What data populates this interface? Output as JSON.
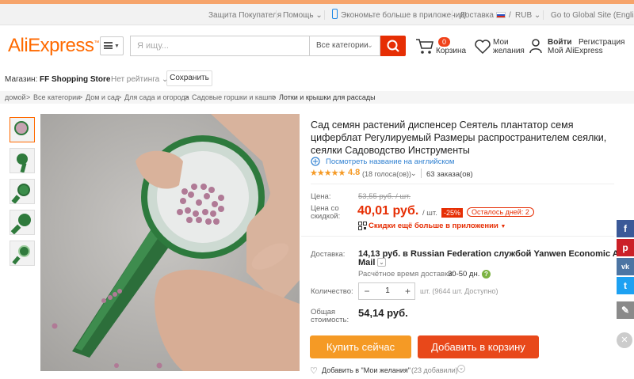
{
  "topbar": {
    "buyer_protection": "Защита Покупателя",
    "help": "Помощь",
    "help_chevron": "⌄",
    "app": "Экономьте больше в приложении!",
    "ship_to": "Доставка в",
    "sep": "/",
    "currency": "RUB",
    "currency_chevron": "⌄",
    "global": "Go to Global Site (English)"
  },
  "header": {
    "logo": "AliExpress",
    "logo_tm": "™",
    "search_placeholder": "Я ищу...",
    "category": "Все категории",
    "cart_count": "0",
    "cart_label": "Корзина",
    "wishlist_line1": "Мои",
    "wishlist_line2": "желания",
    "login": "Войти",
    "register": "Регистрация",
    "my_ali": "Мой AliExpress"
  },
  "store": {
    "label": "Магазин:",
    "name": "FF Shopping Store",
    "rating": "Нет рейтинга",
    "save_btn": "Сохранить"
  },
  "breadcrumb": [
    "домой",
    "Все категории",
    "Дом и сад",
    "Для сада и огорода",
    "Садовые горшки и кашпо",
    "Лотки и крышки для рассады"
  ],
  "breadcrumb_sep": ">",
  "product": {
    "title": "Сад семян растений диспенсер Сеятель плантатор семя циферблат Регулируемый Размеры распространителем сеялки, сеялки Садоводство Инструменты",
    "view_english": "Посмотреть название на английском",
    "stars": "★★★★★",
    "rating": "4.8",
    "reviews": "(18 голоса(ов))",
    "reviews_chevron": "⌄",
    "orders": "63 заказа(ов)",
    "price_label": "Цена:",
    "old_price": "53,55 руб. / шт.",
    "sale_label_1": "Цена со",
    "sale_label_2": "скидкой:",
    "sale_price": "40,01 руб.",
    "sale_unit": "/ шт.",
    "discount": "-25%",
    "days_left": "Осталось дней: 2",
    "app_discount": "Скидки ещё больше в приложении",
    "shipping_label": "Доставка:",
    "shipping_1": "14,13 руб. в Russian Federation службой Yanwen Economic Air",
    "shipping_2": "Mail",
    "est_label": "Расчётное время доставки:",
    "est_value": "30-50 дн.",
    "qty_label": "Количество:",
    "qty_minus": "−",
    "qty_value": "1",
    "qty_plus": "+",
    "qty_avail": "шт. (9644 шт. Доступно)",
    "total_label_1": "Общая",
    "total_label_2": "стоимость:",
    "total": "54,14 руб.",
    "buy_now": "Купить сейчас",
    "add_cart": "Добавить в корзину",
    "wishlist_add": "Добавить в \"Мои желания\"",
    "wishlist_count": "(23 добавили)"
  },
  "colors": {
    "accent": "#ff6a00",
    "red": "#e62e04",
    "buy": "#f59a25",
    "cart": "#e8481a"
  },
  "social_icons": [
    "facebook-icon",
    "pinterest-icon",
    "vk-icon",
    "twitter-icon",
    "edit-icon"
  ],
  "social_glyphs": [
    "f",
    "p",
    "vk",
    "t",
    "✎"
  ],
  "close_glyph": "✕"
}
